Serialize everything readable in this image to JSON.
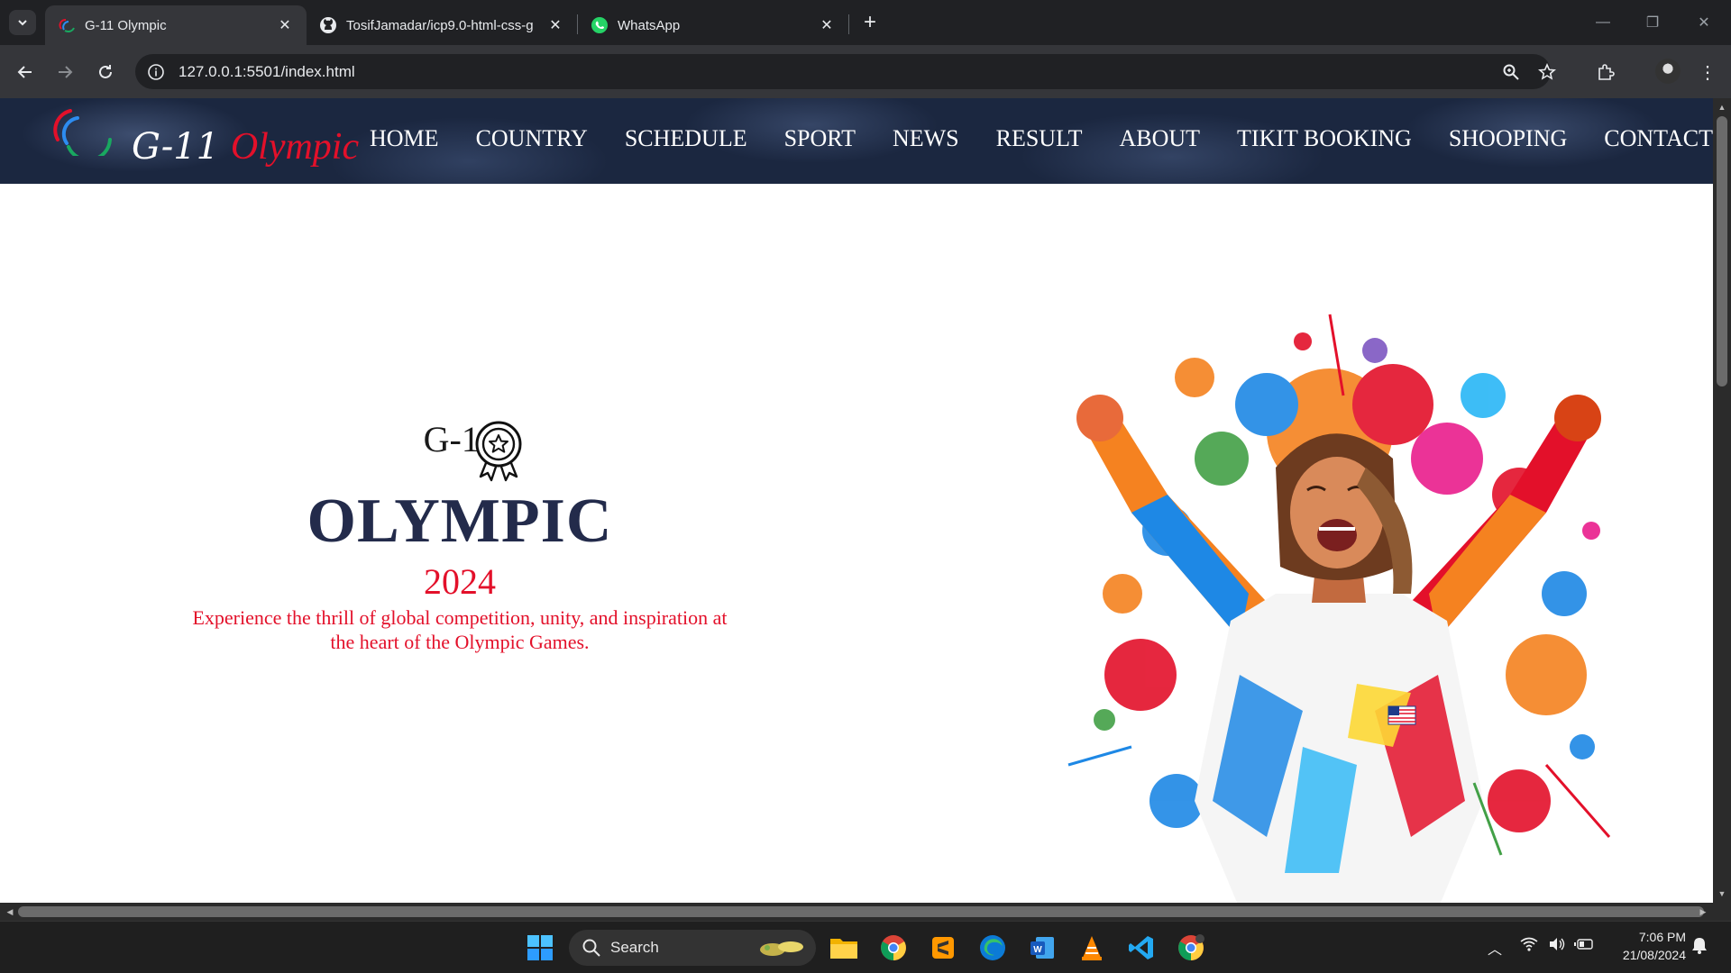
{
  "browser": {
    "tabs": [
      {
        "title": "G-11 Olympic",
        "active": true
      },
      {
        "title": "TosifJamadar/icp9.0-html-css-g",
        "active": false
      },
      {
        "title": "WhatsApp",
        "active": false
      }
    ],
    "url": "127.0.0.1:5501/index.html"
  },
  "site": {
    "logo": {
      "prefix": "G-11",
      "suffix": "Olympic"
    },
    "menu": [
      "HOME",
      "COUNTRY",
      "SCHEDULE",
      "SPORT",
      "NEWS",
      "RESULT",
      "ABOUT",
      "TIKIT BOOKING",
      "SHOOPING",
      "CONTACT"
    ],
    "nav_bg_color": "#1b2740",
    "accent_color": "#e3102a"
  },
  "hero": {
    "subtitle": "G-11",
    "title": "OLYMPIC",
    "year": "2024",
    "tagline": "Experience the thrill of global competition, unity, and inspiration at the heart of the Olympic Games.",
    "image_icon": "cheering-athlete-paint-splash"
  },
  "taskbar": {
    "search_label": "Search",
    "time": "7:06 PM",
    "date": "21/08/2024"
  }
}
